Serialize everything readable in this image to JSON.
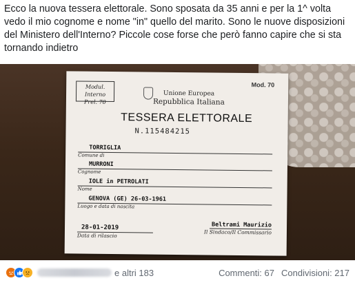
{
  "post": {
    "text": "Ecco la nuova tessera elettorale. Sono sposata da 35 anni e per la 1^ volta vedo il mio cognome e nome \"in\" quello del marito. Sono le nuove disposizioni del Ministero dell'Interno? Piccole cose forse che però fanno capire che si sta tornando indietro"
  },
  "card": {
    "modul_line1": "Modul. Interno",
    "modul_line2": "Prel. 70",
    "mod_number": "Mod. 70",
    "union": "Unione Europea",
    "republic": "Repubblica Italiana",
    "title": "TESSERA ELETTORALE",
    "serial": "N.115484215",
    "fields": [
      {
        "value": "TORRIGLIA",
        "label": "Comune di"
      },
      {
        "value": "MURRONI",
        "label": "Cognome"
      },
      {
        "value": "IOLE in PETROLATI",
        "label": "Nome"
      },
      {
        "value": "GENOVA (GE) 26-03-1961",
        "label": "Luogo e data di nascita"
      }
    ],
    "issue_date": "28-01-2019",
    "issue_label": "Data di rilascio",
    "signer": "Beltrami Maurizio",
    "signer_label": "Il Sindaco/Il Commissario"
  },
  "footer": {
    "others": "e altri 183",
    "comments": "Commenti: 67",
    "shares": "Condivisioni: 217"
  },
  "colors": {
    "angry": "#e9710f",
    "like": "#1877f2",
    "sad": "#f7b125"
  }
}
